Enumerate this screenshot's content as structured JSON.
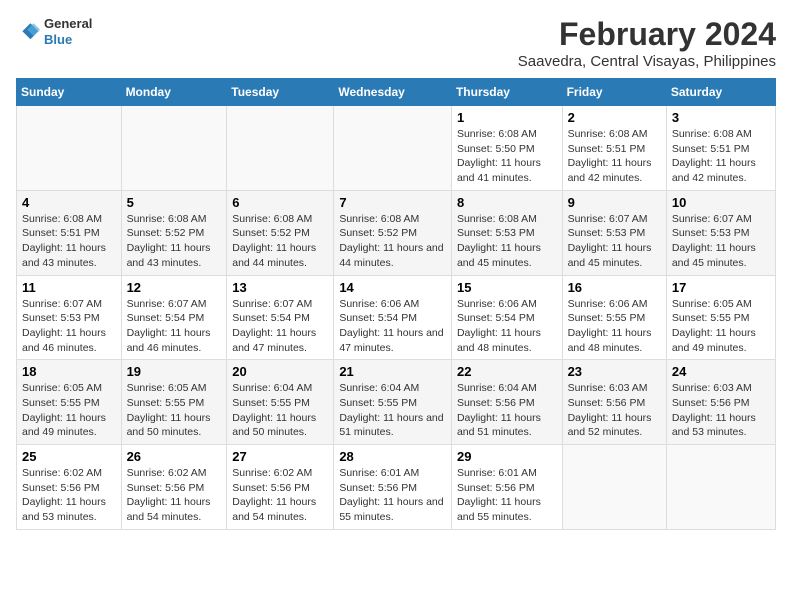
{
  "logo": {
    "line1": "General",
    "line2": "Blue"
  },
  "title": "February 2024",
  "subtitle": "Saavedra, Central Visayas, Philippines",
  "days_of_week": [
    "Sunday",
    "Monday",
    "Tuesday",
    "Wednesday",
    "Thursday",
    "Friday",
    "Saturday"
  ],
  "weeks": [
    [
      {
        "num": "",
        "info": ""
      },
      {
        "num": "",
        "info": ""
      },
      {
        "num": "",
        "info": ""
      },
      {
        "num": "",
        "info": ""
      },
      {
        "num": "1",
        "info": "Sunrise: 6:08 AM\nSunset: 5:50 PM\nDaylight: 11 hours and 41 minutes."
      },
      {
        "num": "2",
        "info": "Sunrise: 6:08 AM\nSunset: 5:51 PM\nDaylight: 11 hours and 42 minutes."
      },
      {
        "num": "3",
        "info": "Sunrise: 6:08 AM\nSunset: 5:51 PM\nDaylight: 11 hours and 42 minutes."
      }
    ],
    [
      {
        "num": "4",
        "info": "Sunrise: 6:08 AM\nSunset: 5:51 PM\nDaylight: 11 hours and 43 minutes."
      },
      {
        "num": "5",
        "info": "Sunrise: 6:08 AM\nSunset: 5:52 PM\nDaylight: 11 hours and 43 minutes."
      },
      {
        "num": "6",
        "info": "Sunrise: 6:08 AM\nSunset: 5:52 PM\nDaylight: 11 hours and 44 minutes."
      },
      {
        "num": "7",
        "info": "Sunrise: 6:08 AM\nSunset: 5:52 PM\nDaylight: 11 hours and 44 minutes."
      },
      {
        "num": "8",
        "info": "Sunrise: 6:08 AM\nSunset: 5:53 PM\nDaylight: 11 hours and 45 minutes."
      },
      {
        "num": "9",
        "info": "Sunrise: 6:07 AM\nSunset: 5:53 PM\nDaylight: 11 hours and 45 minutes."
      },
      {
        "num": "10",
        "info": "Sunrise: 6:07 AM\nSunset: 5:53 PM\nDaylight: 11 hours and 45 minutes."
      }
    ],
    [
      {
        "num": "11",
        "info": "Sunrise: 6:07 AM\nSunset: 5:53 PM\nDaylight: 11 hours and 46 minutes."
      },
      {
        "num": "12",
        "info": "Sunrise: 6:07 AM\nSunset: 5:54 PM\nDaylight: 11 hours and 46 minutes."
      },
      {
        "num": "13",
        "info": "Sunrise: 6:07 AM\nSunset: 5:54 PM\nDaylight: 11 hours and 47 minutes."
      },
      {
        "num": "14",
        "info": "Sunrise: 6:06 AM\nSunset: 5:54 PM\nDaylight: 11 hours and 47 minutes."
      },
      {
        "num": "15",
        "info": "Sunrise: 6:06 AM\nSunset: 5:54 PM\nDaylight: 11 hours and 48 minutes."
      },
      {
        "num": "16",
        "info": "Sunrise: 6:06 AM\nSunset: 5:55 PM\nDaylight: 11 hours and 48 minutes."
      },
      {
        "num": "17",
        "info": "Sunrise: 6:05 AM\nSunset: 5:55 PM\nDaylight: 11 hours and 49 minutes."
      }
    ],
    [
      {
        "num": "18",
        "info": "Sunrise: 6:05 AM\nSunset: 5:55 PM\nDaylight: 11 hours and 49 minutes."
      },
      {
        "num": "19",
        "info": "Sunrise: 6:05 AM\nSunset: 5:55 PM\nDaylight: 11 hours and 50 minutes."
      },
      {
        "num": "20",
        "info": "Sunrise: 6:04 AM\nSunset: 5:55 PM\nDaylight: 11 hours and 50 minutes."
      },
      {
        "num": "21",
        "info": "Sunrise: 6:04 AM\nSunset: 5:55 PM\nDaylight: 11 hours and 51 minutes."
      },
      {
        "num": "22",
        "info": "Sunrise: 6:04 AM\nSunset: 5:56 PM\nDaylight: 11 hours and 51 minutes."
      },
      {
        "num": "23",
        "info": "Sunrise: 6:03 AM\nSunset: 5:56 PM\nDaylight: 11 hours and 52 minutes."
      },
      {
        "num": "24",
        "info": "Sunrise: 6:03 AM\nSunset: 5:56 PM\nDaylight: 11 hours and 53 minutes."
      }
    ],
    [
      {
        "num": "25",
        "info": "Sunrise: 6:02 AM\nSunset: 5:56 PM\nDaylight: 11 hours and 53 minutes."
      },
      {
        "num": "26",
        "info": "Sunrise: 6:02 AM\nSunset: 5:56 PM\nDaylight: 11 hours and 54 minutes."
      },
      {
        "num": "27",
        "info": "Sunrise: 6:02 AM\nSunset: 5:56 PM\nDaylight: 11 hours and 54 minutes."
      },
      {
        "num": "28",
        "info": "Sunrise: 6:01 AM\nSunset: 5:56 PM\nDaylight: 11 hours and 55 minutes."
      },
      {
        "num": "29",
        "info": "Sunrise: 6:01 AM\nSunset: 5:56 PM\nDaylight: 11 hours and 55 minutes."
      },
      {
        "num": "",
        "info": ""
      },
      {
        "num": "",
        "info": ""
      }
    ]
  ]
}
